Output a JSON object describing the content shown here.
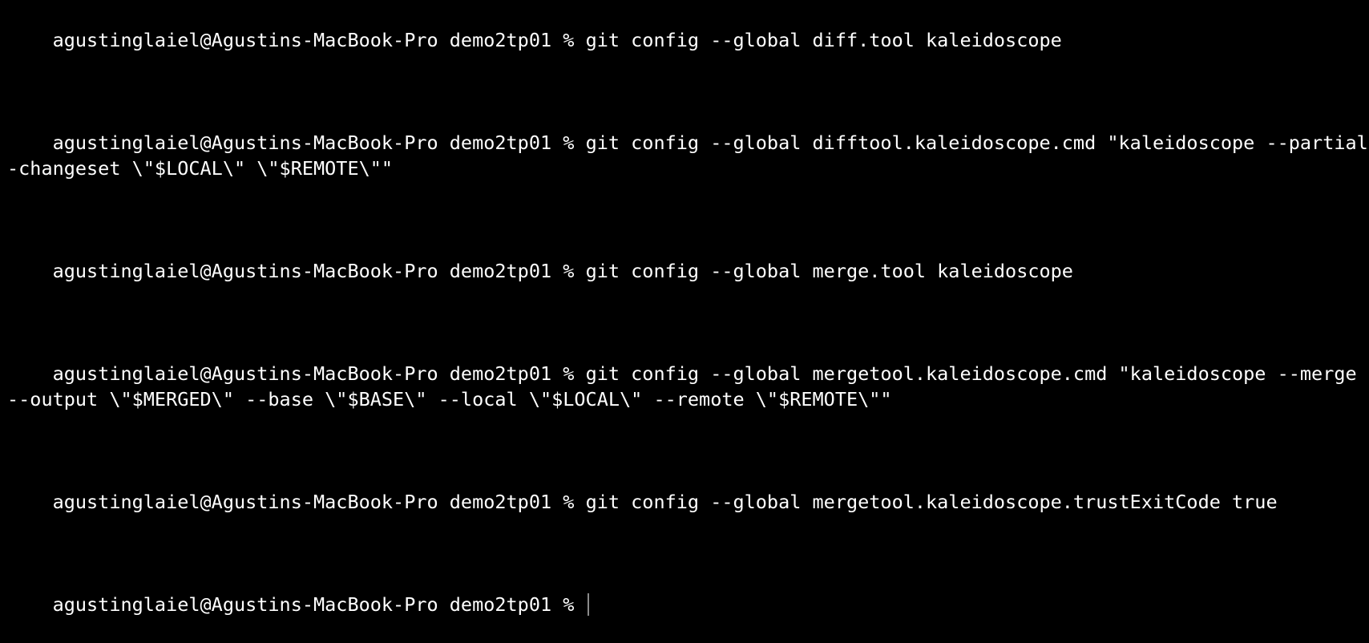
{
  "colors": {
    "background": "#000000",
    "text": "#ffffff",
    "cursor": "#8a8a8a"
  },
  "terminal": {
    "entries": [
      {
        "prompt": "agustinglaiel@Agustins-MacBook-Pro demo2tp01 % ",
        "command": "git config --global diff.tool kaleidoscope"
      },
      {
        "prompt": "agustinglaiel@Agustins-MacBook-Pro demo2tp01 % ",
        "command": "git config --global difftool.kaleidoscope.cmd \"kaleidoscope --partial-changeset \\\"$LOCAL\\\" \\\"$REMOTE\\\"\""
      },
      {
        "prompt": "agustinglaiel@Agustins-MacBook-Pro demo2tp01 % ",
        "command": "git config --global merge.tool kaleidoscope"
      },
      {
        "prompt": "agustinglaiel@Agustins-MacBook-Pro demo2tp01 % ",
        "command": "git config --global mergetool.kaleidoscope.cmd \"kaleidoscope --merge --output \\\"$MERGED\\\" --base \\\"$BASE\\\" --local \\\"$LOCAL\\\" --remote \\\"$REMOTE\\\"\""
      },
      {
        "prompt": "agustinglaiel@Agustins-MacBook-Pro demo2tp01 % ",
        "command": "git config --global mergetool.kaleidoscope.trustExitCode true"
      },
      {
        "prompt": "agustinglaiel@Agustins-MacBook-Pro demo2tp01 % ",
        "command": ""
      }
    ]
  }
}
